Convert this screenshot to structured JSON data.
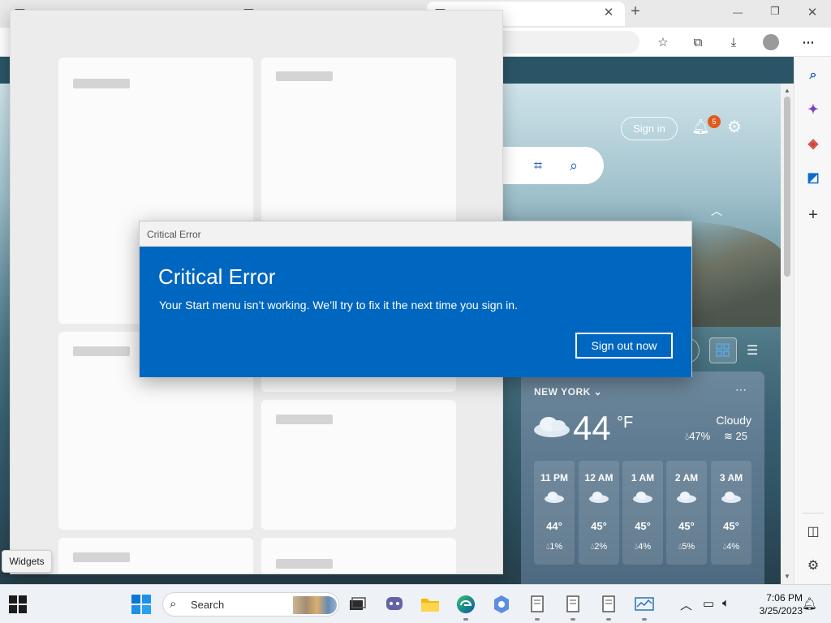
{
  "browser": {
    "window_controls": {
      "new_tab": "+",
      "minimize": "—",
      "restore": "❐",
      "close": "✕"
    },
    "tab_close": "✕",
    "toolbar_icons": [
      "favorites-star-icon",
      "collections-icon",
      "downloads-icon",
      "profile-icon",
      "more-icon"
    ],
    "sidebar_icons": [
      "search-icon",
      "copilot-icon",
      "office-icon",
      "outlook-icon",
      "add-icon",
      "split-screen-icon",
      "settings-icon"
    ]
  },
  "newtab": {
    "signin_label": "Sign in",
    "notification_count": "5"
  },
  "weather": {
    "city": "NEW YORK",
    "temperature": "44",
    "unit": "°F",
    "condition": "Cloudy",
    "humidity": "47%",
    "wind": "25",
    "hourly": [
      {
        "time": "11 PM",
        "temp": "44°",
        "precip": "1%"
      },
      {
        "time": "12 AM",
        "temp": "45°",
        "precip": "2%"
      },
      {
        "time": "1 AM",
        "temp": "45°",
        "precip": "4%"
      },
      {
        "time": "2 AM",
        "temp": "45°",
        "precip": "5%"
      },
      {
        "time": "3 AM",
        "temp": "45°",
        "precip": "4%"
      }
    ]
  },
  "dialog": {
    "title": "Critical Error",
    "heading": "Critical Error",
    "message": "Your Start menu isn’t working. We’ll try to fix it the next time you sign in.",
    "button": "Sign out now"
  },
  "tooltip": {
    "label": "Widgets"
  },
  "taskbar": {
    "search_placeholder": "Search",
    "clock_time": "7:06 PM",
    "clock_date": "3/25/2023"
  },
  "colors": {
    "dialog_blue": "#0067c0",
    "badge_orange": "#e05a1e",
    "edge_blue": "#1a62b3"
  }
}
